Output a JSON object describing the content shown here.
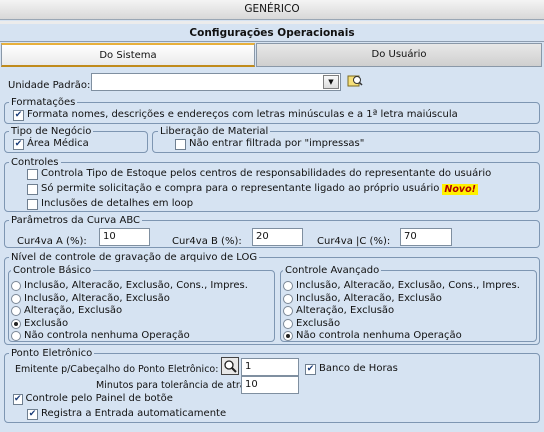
{
  "header": {
    "window_title": "GENÉRICO",
    "section_title": "Configurações Operacionais"
  },
  "tabs": [
    {
      "label": "Do Sistema"
    },
    {
      "label": "Do Usuário"
    }
  ],
  "unidade": {
    "label": "Unidade Padrão:",
    "value": ""
  },
  "formatacoes": {
    "title": "Formatações",
    "option": "Formata nomes, descrições e endereços com letras minúsculas e a 1ª letra maiúscula",
    "checked": true
  },
  "tipo_negocio": {
    "title": "Tipo de Negócio",
    "option": "Área Médica",
    "checked": true
  },
  "liberacao": {
    "title": "Liberação de Material",
    "option": "Não entrar filtrada por \"impressas\"",
    "checked": false
  },
  "controles": {
    "title": "Controles",
    "items": [
      {
        "label": "Controla Tipo de Estoque pelos centros de responsabilidades do representante do usuário",
        "checked": false
      },
      {
        "label": "Só permite solicitação e compra para o representante ligado ao próprio usuário",
        "checked": false,
        "badge": "Novo!"
      },
      {
        "label": "Inclusões de detalhes em loop",
        "checked": false
      }
    ]
  },
  "curva": {
    "title": "Parâmetros da Curva ABC",
    "a_label": "Cur4va A  (%):",
    "a_value": "10",
    "b_label": "Cur4va B  (%):",
    "b_value": "20",
    "c_label": "Cur4va |C  (%):",
    "c_value": "70"
  },
  "log": {
    "title": "Nível de controle de gravação de arquivo de LOG",
    "basico": {
      "title": "Controle Básico",
      "options": [
        "Inclusão, Alteracão, Exclusão, Cons., Impres.",
        "Inclusão, Alteracão, Exclusão",
        "Alteração, Exclusão",
        "Exclusão",
        "Não controla nenhuma Operação"
      ],
      "selected": 3
    },
    "avancado": {
      "title": "Controle Avançado",
      "options": [
        "Inclusão, Alteracão, Exclusão, Cons., Impres.",
        "Inclusão, Alteracão, Exclusão",
        "Alteração, Exclusão",
        "Exclusão",
        "Não controla nenhuma Operação"
      ],
      "selected": 4
    }
  },
  "ponto": {
    "title": "Ponto Eletrônico",
    "emitente_label": "Emitente p/Cabeçalho do Ponto Eletrônico:",
    "emitente_value": "1",
    "banco_label": "Banco de Horas",
    "banco_checked": true,
    "tolerancia_label": "Minutos para tolerância de atraso:",
    "tolerancia_value": "10",
    "painel_label": "Controle pelo Painel de botões",
    "painel_checked": true,
    "registra_label": "Registra a Entrada automaticamente",
    "registra_checked": true
  }
}
